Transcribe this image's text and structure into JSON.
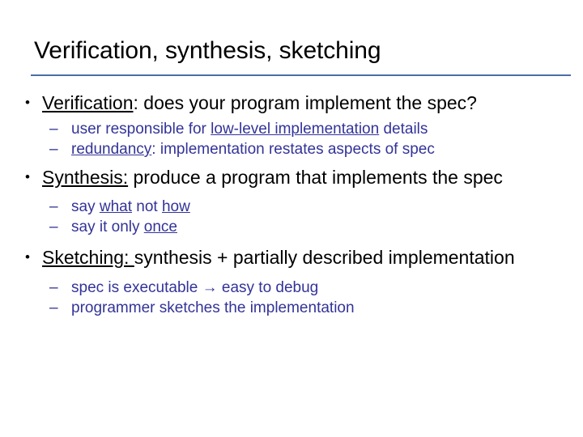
{
  "slide": {
    "title": "Verification, synthesis, sketching",
    "rule_color": "#4a6fa5",
    "title_color": "#000000",
    "level1_color": "#000000",
    "level2_color": "#333399",
    "background_color": "#ffffff",
    "level1_marker": "•",
    "level2_marker": "–"
  },
  "bullets": [
    {
      "term": "Verification",
      "term_underlined": true,
      "rest": ": does your program implement the spec?",
      "sub": [
        {
          "pre": "user responsible for ",
          "emph": "low-level implementation",
          "emph_underlined": true,
          "post": " details"
        },
        {
          "pre": "",
          "emph": "redundancy",
          "emph_underlined": true,
          "post": ":  implementation restates aspects of spec"
        }
      ]
    },
    {
      "term": "Synthesis:",
      "term_underlined": true,
      "rest": " produce a program that implements the spec",
      "sub": [
        {
          "pre": "say ",
          "emph": "what",
          "emph_underlined": true,
          "post": " not ",
          "emph2": "how",
          "emph2_underlined": true,
          "post2": ""
        },
        {
          "pre": "say it only ",
          "emph": "once",
          "emph_underlined": true,
          "post": ""
        }
      ]
    },
    {
      "term": "Sketching: ",
      "term_underlined": true,
      "rest": "synthesis + partially described implementation",
      "sub": [
        {
          "pre": "spec is executable → easy to debug",
          "emph": "",
          "emph_underlined": false,
          "post": ""
        },
        {
          "pre": "programmer sketches the implementation",
          "emph": "",
          "emph_underlined": false,
          "post": ""
        }
      ]
    }
  ]
}
